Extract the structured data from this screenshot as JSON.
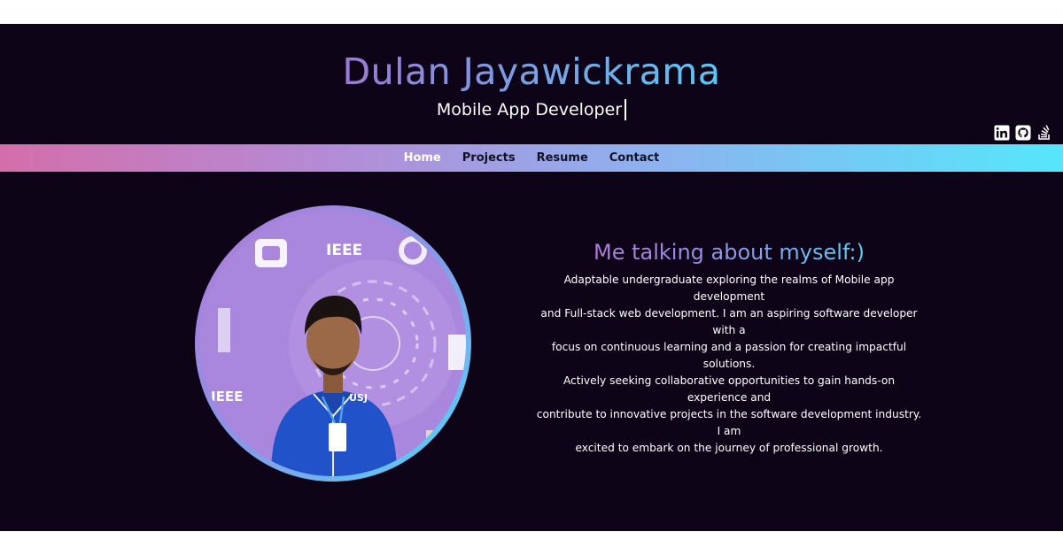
{
  "header": {
    "title": "Dulan Jayawickrama",
    "subtitle": "Mobile App Developer"
  },
  "social": [
    {
      "icon": "linkedin-icon",
      "name": "LinkedIn"
    },
    {
      "icon": "github-icon",
      "name": "GitHub"
    },
    {
      "icon": "stackoverflow-icon",
      "name": "Stack Overflow"
    }
  ],
  "nav": {
    "items": [
      "Home",
      "Projects",
      "Resume",
      "Contact"
    ],
    "active": "Home"
  },
  "about": {
    "heading": "Me talking about myself:)",
    "lines": [
      "Adaptable undergraduate exploring the realms of Mobile app development",
      "and Full-stack web development. I am an aspiring software developer with a",
      "focus on continuous learning and a passion for creating impactful solutions.",
      "Actively seeking collaborative opportunities to gain hands-on experience and",
      "contribute to innovative projects in the software development industry. I am",
      "excited to embark on the journey of professional growth."
    ]
  },
  "photo": {
    "badge_text": "IEEE",
    "shirt_text": "USJ"
  },
  "colors": {
    "page_background": "#0e0418",
    "accent_pink": "#d46eaa",
    "accent_purple": "#9c7fd6",
    "accent_cyan": "#56e6fb"
  }
}
